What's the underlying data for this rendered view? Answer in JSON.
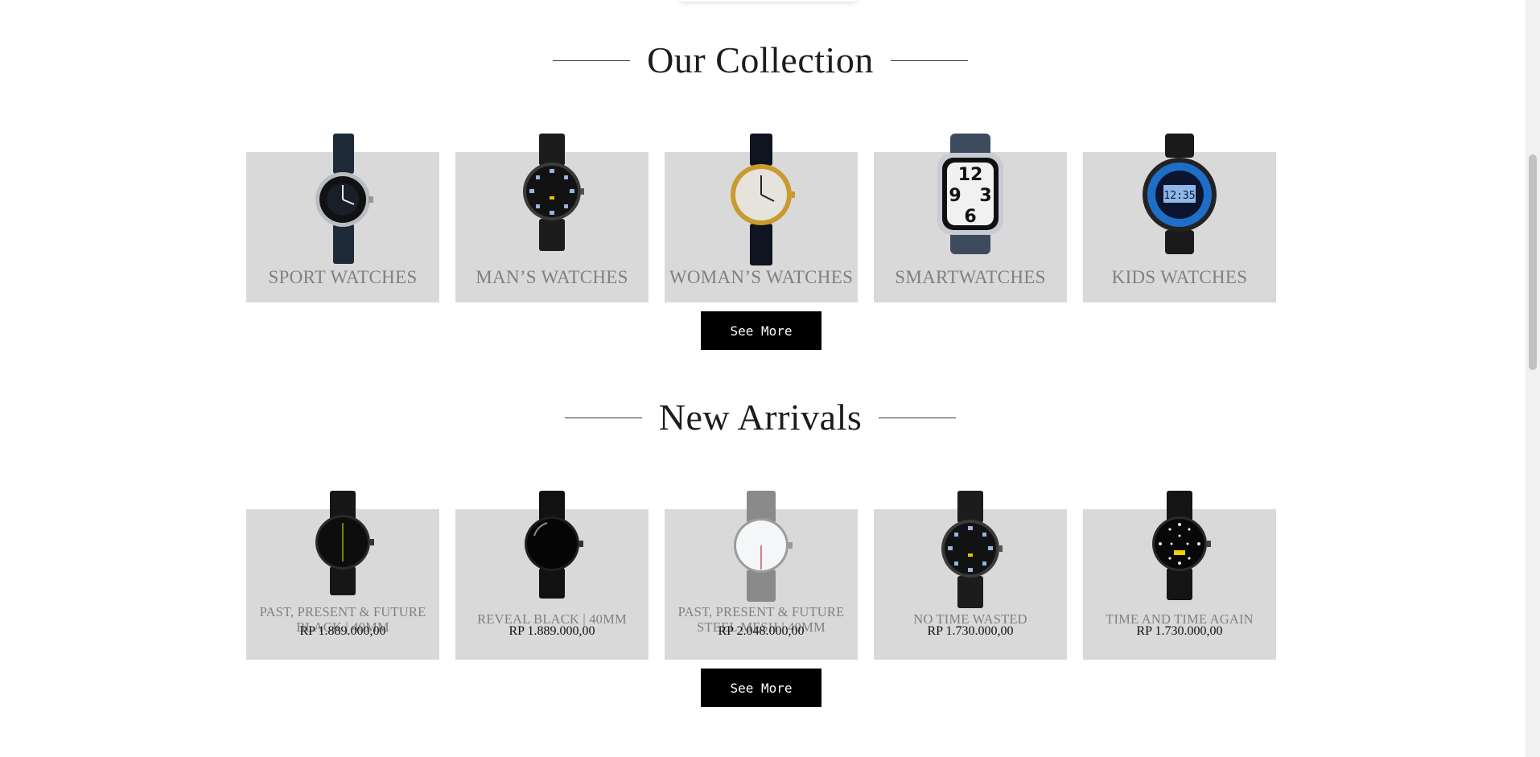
{
  "collection": {
    "title": "Our Collection",
    "items": [
      {
        "label": "SPORT WATCHES",
        "icon": "sport-watch-icon"
      },
      {
        "label": "MAN’S WATCHES",
        "icon": "mens-watch-icon"
      },
      {
        "label": "WOMAN’S WATCHES",
        "icon": "womens-watch-icon"
      },
      {
        "label": "SMARTWATCHES",
        "icon": "smartwatch-icon"
      },
      {
        "label": "KIDS WATCHES",
        "icon": "kids-watch-icon"
      }
    ],
    "see_more": "See More"
  },
  "arrivals": {
    "title": "New Arrivals",
    "items": [
      {
        "line1": "PAST, PRESENT & FUTURE",
        "line2": "BLACK | 40MM",
        "price": "RP 1.889.000,00"
      },
      {
        "line1": "REVEAL BLACK | 40MM",
        "line2": "",
        "price": "RP 1.889.000,00"
      },
      {
        "line1": "PAST, PRESENT & FUTURE",
        "line2": "STEEL MESH | 40MM",
        "price": "RP 2.048.000,00"
      },
      {
        "line1": "NO TIME WASTED",
        "line2": "",
        "price": "RP 1.730.000,00"
      },
      {
        "line1": "TIME AND TIME AGAIN",
        "line2": "",
        "price": "RP 1.730.000,00"
      }
    ],
    "see_more": "See More"
  },
  "colors": {
    "card_bg": "#d9d9d9",
    "button_bg": "#000000",
    "label_gray": "#808080"
  }
}
